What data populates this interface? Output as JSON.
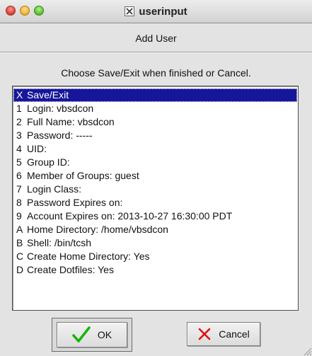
{
  "window": {
    "title": "userinput"
  },
  "dialog": {
    "title": "Add User",
    "instruction": "Choose Save/Exit when finished or Cancel."
  },
  "list": {
    "items": [
      {
        "key": "X",
        "label": "Save/Exit",
        "selected": true
      },
      {
        "key": "1",
        "label": "Login: vbsdcon"
      },
      {
        "key": "2",
        "label": "Full Name: vbsdcon"
      },
      {
        "key": "3",
        "label": "Password: -----"
      },
      {
        "key": "4",
        "label": "UID:"
      },
      {
        "key": "5",
        "label": "Group ID:"
      },
      {
        "key": "6",
        "label": "Member of Groups: guest"
      },
      {
        "key": "7",
        "label": "Login Class:"
      },
      {
        "key": "8",
        "label": "Password Expires on:"
      },
      {
        "key": "9",
        "label": "Account Expires on: 2013-10-27 16:30:00 PDT"
      },
      {
        "key": "A",
        "label": "Home Directory: /home/vbsdcon"
      },
      {
        "key": "B",
        "label": "Shell: /bin/tcsh"
      },
      {
        "key": "C",
        "label": "Create Home Directory: Yes"
      },
      {
        "key": "D",
        "label": "Create Dotfiles: Yes"
      }
    ]
  },
  "buttons": {
    "ok_label": "OK",
    "cancel_label": "Cancel",
    "ok_icon": "checkmark-icon",
    "cancel_icon": "x-mark-icon"
  },
  "colors": {
    "selection": "#16169a",
    "ok_check": "#16b40a",
    "cancel_x": "#e0100c"
  }
}
